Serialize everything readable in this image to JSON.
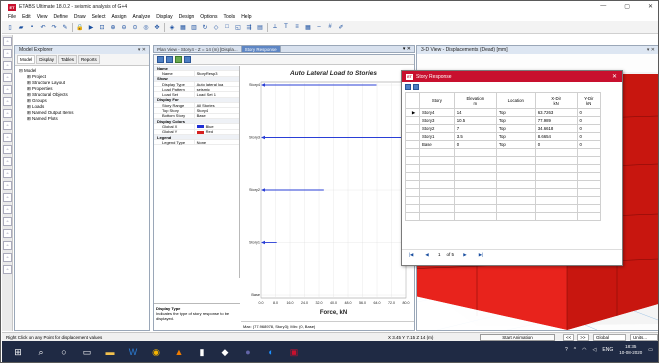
{
  "window": {
    "title": "ETABS Ultimate 18.0.2 - seismic analysis of G+4",
    "logo": "ET",
    "min": "—",
    "max": "▢",
    "close": "✕"
  },
  "menu": [
    "File",
    "Edit",
    "View",
    "Define",
    "Draw",
    "Select",
    "Assign",
    "Analyze",
    "Display",
    "Design",
    "Options",
    "Tools",
    "Help"
  ],
  "toolbar_icons": [
    "new-icon",
    "open-icon",
    "save-icon",
    "undo-icon",
    "redo-icon",
    "pencil-icon",
    "lock-icon",
    "run-icon",
    "zoom-window-icon",
    "zoom-in-icon",
    "zoom-out-icon",
    "zoom-fit-icon",
    "zoom-prev-icon",
    "pan-icon",
    "3d-view-icon",
    "plan-view-icon",
    "elevation-icon",
    "rotate-icon",
    "perspective-icon",
    "undeformed-icon",
    "deformed-icon",
    "forces-icon",
    "design-icon",
    "ruler-icon",
    "text-icon",
    "chart-icon",
    "table-icon",
    "dash-icon",
    "grid-icon",
    "pencil2-icon"
  ],
  "explorer": {
    "title": "Model Explorer",
    "tabs": [
      "Model",
      "Display",
      "Tables",
      "Reports"
    ],
    "root": "Model",
    "items": [
      "Project",
      "Structure Layout",
      "Properties",
      "Structural Objects",
      "Groups",
      "Loads",
      "Named Output Items",
      "Named Plots"
    ]
  },
  "doc_tabs": {
    "plan": "Plan View - Story4 - Z = 14 (m) [Displa...",
    "response": "Story Response",
    "view3d": "3-D View - Displacements (Dead) [mm]",
    "pin": "▾ ✕"
  },
  "properties": [
    {
      "type": "sec",
      "k": "Name"
    },
    {
      "k": "Name",
      "v": "StoryResp3"
    },
    {
      "type": "sec",
      "k": "Show"
    },
    {
      "k": "Display Type",
      "v": "Auto lateral loa"
    },
    {
      "k": "Load Pattern",
      "v": "seismic"
    },
    {
      "k": "Load Set",
      "v": "Load Set 1"
    },
    {
      "type": "sec",
      "k": "Display For"
    },
    {
      "k": "Story Range",
      "v": "All Stories"
    },
    {
      "k": "Top Story",
      "v": "Story4"
    },
    {
      "k": "Bottom Story",
      "v": "Base"
    },
    {
      "type": "sec",
      "k": "Display Colors"
    },
    {
      "k": "Global X",
      "v": "Blue",
      "color": "#1f2fd6"
    },
    {
      "k": "Global Y",
      "v": "Red",
      "color": "#d61f1f"
    },
    {
      "type": "sec",
      "k": "Legend"
    },
    {
      "k": "Legend Type",
      "v": "None"
    }
  ],
  "help": {
    "title": "Display Type",
    "text": "Indicates the type of story response to be displayed."
  },
  "max_line": "Max: (77.968978, Story3); Min: (0, Base)",
  "chart_data": {
    "type": "bar",
    "orientation": "horizontal",
    "title": "Auto Lateral Load to Stories",
    "xlabel": "Force, kN",
    "ylabel": "",
    "categories": [
      "Base",
      "Story1",
      "Story2",
      "Story3",
      "Story4"
    ],
    "values": [
      0,
      8.6654,
      34.6618,
      77.989,
      63.7263
    ],
    "series_color": "#2a3fd6",
    "xlim": [
      0,
      80
    ],
    "xticks": [
      "0.0",
      "8.0",
      "16.0",
      "24.0",
      "32.0",
      "40.0",
      "48.0",
      "56.0",
      "64.0",
      "72.0",
      "80.0"
    ],
    "grid": true,
    "legend": "none"
  },
  "dialog": {
    "title": "Story Response",
    "logo": "ET",
    "close": "✕",
    "columns": [
      {
        "name": "Story",
        "unit": ""
      },
      {
        "name": "Elevation",
        "unit": "m"
      },
      {
        "name": "Location",
        "unit": ""
      },
      {
        "name": "X-Dir",
        "unit": "kN"
      },
      {
        "name": "Y-Dir",
        "unit": "kN"
      }
    ],
    "rows": [
      {
        "story": "Story4",
        "elev": "14",
        "loc": "Top",
        "x": "63.7263",
        "y": "0",
        "selected": true
      },
      {
        "story": "Story3",
        "elev": "10.5",
        "loc": "Top",
        "x": "77.989",
        "y": "0"
      },
      {
        "story": "Story2",
        "elev": "7",
        "loc": "Top",
        "x": "34.6618",
        "y": "0"
      },
      {
        "story": "Story1",
        "elev": "3.5",
        "loc": "Top",
        "x": "8.6654",
        "y": "0"
      },
      {
        "story": "Base",
        "elev": "0",
        "loc": "Top",
        "x": "0",
        "y": "0"
      }
    ],
    "nav": {
      "first": "|◀",
      "prev": "◀",
      "page": "1",
      "of": "of 5",
      "next": "▶",
      "last": "▶|"
    }
  },
  "status": {
    "hint": "Right Click on any Point for displacement values",
    "coords": "X 3.45  Y 7.15  Z 14 (m)",
    "animation": "Start Animation",
    "nav_prev": "<<",
    "nav_next": ">>",
    "coord_sys": "Global",
    "units": "Units..."
  },
  "taskbar": {
    "icons": [
      "windows-start-icon",
      "search-icon",
      "task-view-icon",
      "widget-icon",
      "file-explorer-icon",
      "word-icon",
      "chrome-icon",
      "vlc-icon",
      "notepad-icon",
      "media-icon",
      "teams-icon",
      "edge-icon",
      "etabs-icon"
    ],
    "lang": "ENG",
    "time": "18:35",
    "date": "10-08-2020"
  }
}
